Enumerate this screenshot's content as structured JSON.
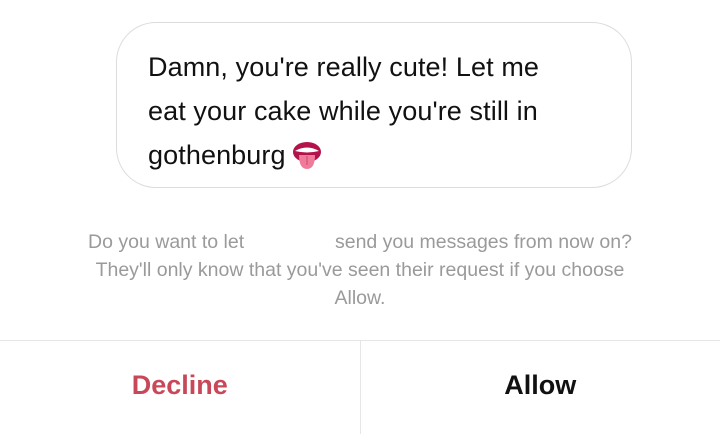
{
  "message": {
    "line1": "Damn, you're really cute! Let me",
    "line2": "eat your cake while you're still in",
    "line3": "gothenburg",
    "emoji": "tongue-out-face-icon"
  },
  "prompt": {
    "line1_before": "Do you want to let",
    "line1_after": "send you messages from now on?",
    "line2": "They'll only know that you've seen their request if you choose",
    "line3": "Allow."
  },
  "actions": {
    "decline_label": "Decline",
    "allow_label": "Allow"
  },
  "colors": {
    "decline": "#c8485a",
    "prompt_text": "#9a9a9a",
    "bubble_border": "#dcdcdc"
  }
}
